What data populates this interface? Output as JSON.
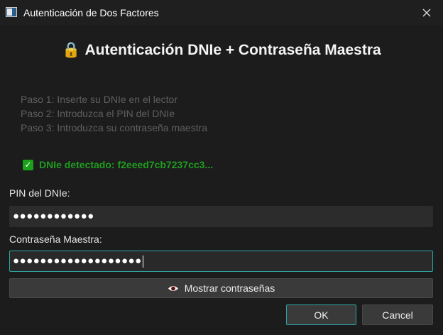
{
  "window": {
    "title": "Autenticación de Dos Factores",
    "icon": "window-app-icon",
    "close_icon": "close-icon"
  },
  "header": {
    "lock_icon": "lock-icon",
    "lock_glyph": "🔒",
    "title": "Autenticación DNIe + Contraseña Maestra"
  },
  "steps": [
    "Paso 1: Inserte su DNIe en el lector",
    "Paso 2: Introduzca el PIN del DNIe",
    "Paso 3: Introduzca su contraseña maestra"
  ],
  "status": {
    "icon": "checkbox-checked-icon",
    "check_glyph": "✓",
    "text": "DNIe detectado: f2eeed7cb7237cc3...",
    "color": "#1f9d1f"
  },
  "pin": {
    "label": "PIN del DNIe:",
    "value": "●●●●●●●●●●●●"
  },
  "password": {
    "label": "Contraseña Maestra:",
    "value": "●●●●●●●●●●●●●●●●●●●"
  },
  "show_button": {
    "icon": "eye-icon",
    "label": "Mostrar contraseñas"
  },
  "dialog_buttons": {
    "ok": "OK",
    "cancel": "Cancel"
  },
  "colors": {
    "background": "#1c1c1c",
    "accent": "#2aa4a4",
    "success": "#1f9d1f",
    "lock": "#f2b400"
  }
}
